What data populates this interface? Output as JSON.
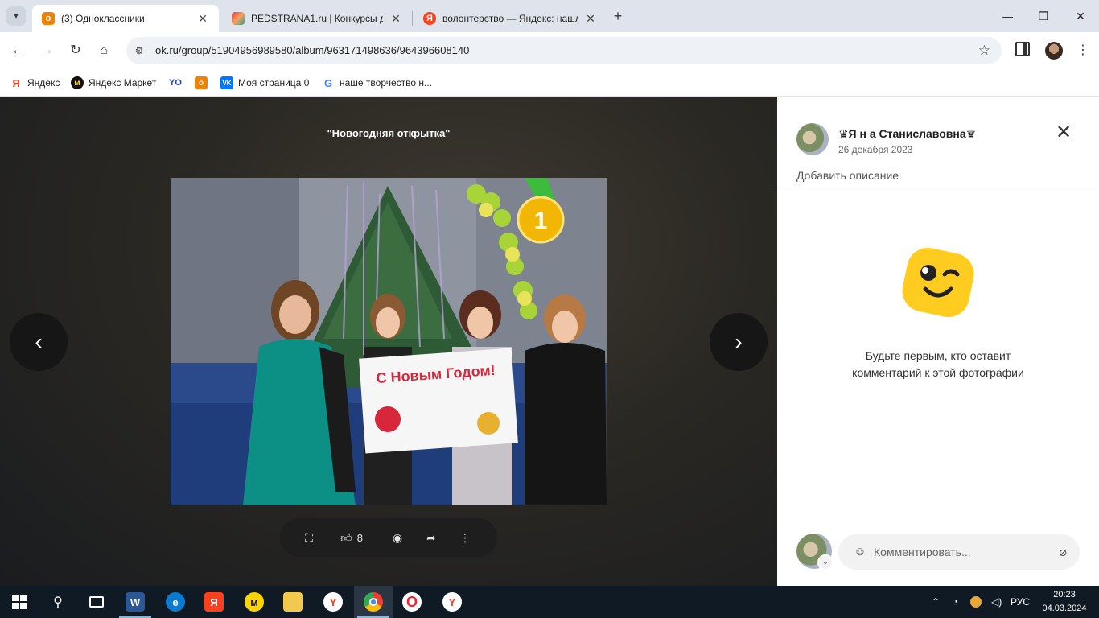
{
  "browser": {
    "tabs": [
      {
        "title": "(3) Одноклассники",
        "favicon": "odnoklassniki-icon",
        "active": true
      },
      {
        "title": "PEDSTRANA1.ru | Конкурсы дл",
        "favicon": "pedstrana-icon",
        "active": false
      },
      {
        "title": "волонтерство — Яндекс: нашл",
        "favicon": "yandex-icon",
        "active": false
      }
    ],
    "url": "ok.ru/group/51904956989580/album/963171498636/964396608140",
    "bookmarks": [
      {
        "label": "Яндекс",
        "icon": "yandex-icon"
      },
      {
        "label": "Яндекс Маркет",
        "icon": "yandex-market-icon"
      },
      {
        "label": "",
        "icon": "yoomoney-icon"
      },
      {
        "label": "",
        "icon": "odnoklassniki-icon"
      },
      {
        "label": "Моя страница 0",
        "icon": "vk-icon"
      },
      {
        "label": "наше творчество н...",
        "icon": "google-icon"
      }
    ]
  },
  "viewer": {
    "caption": "\"Новогодняя открытка\"",
    "likes": "8",
    "medal_number": "1",
    "poster_text": "С Новым Годом!"
  },
  "panel": {
    "author": "♛Я н а Станиславовна♛",
    "date": "26 декабря 2023",
    "add_description": "Добавить описание",
    "empty_line1": "Будьте первым, кто оставит",
    "empty_line2": "комментарий к этой фотографии",
    "comment_placeholder": "Комментировать..."
  },
  "taskbar": {
    "lang": "РУС",
    "time": "20:23",
    "date": "04.03.2024"
  },
  "colors": {
    "ok_orange": "#ee8208",
    "yandex_red": "#fc3f1d",
    "vk_blue": "#0077ff",
    "viewer_bg": "#2a2823",
    "emoji_yellow": "#ffcc1f"
  }
}
